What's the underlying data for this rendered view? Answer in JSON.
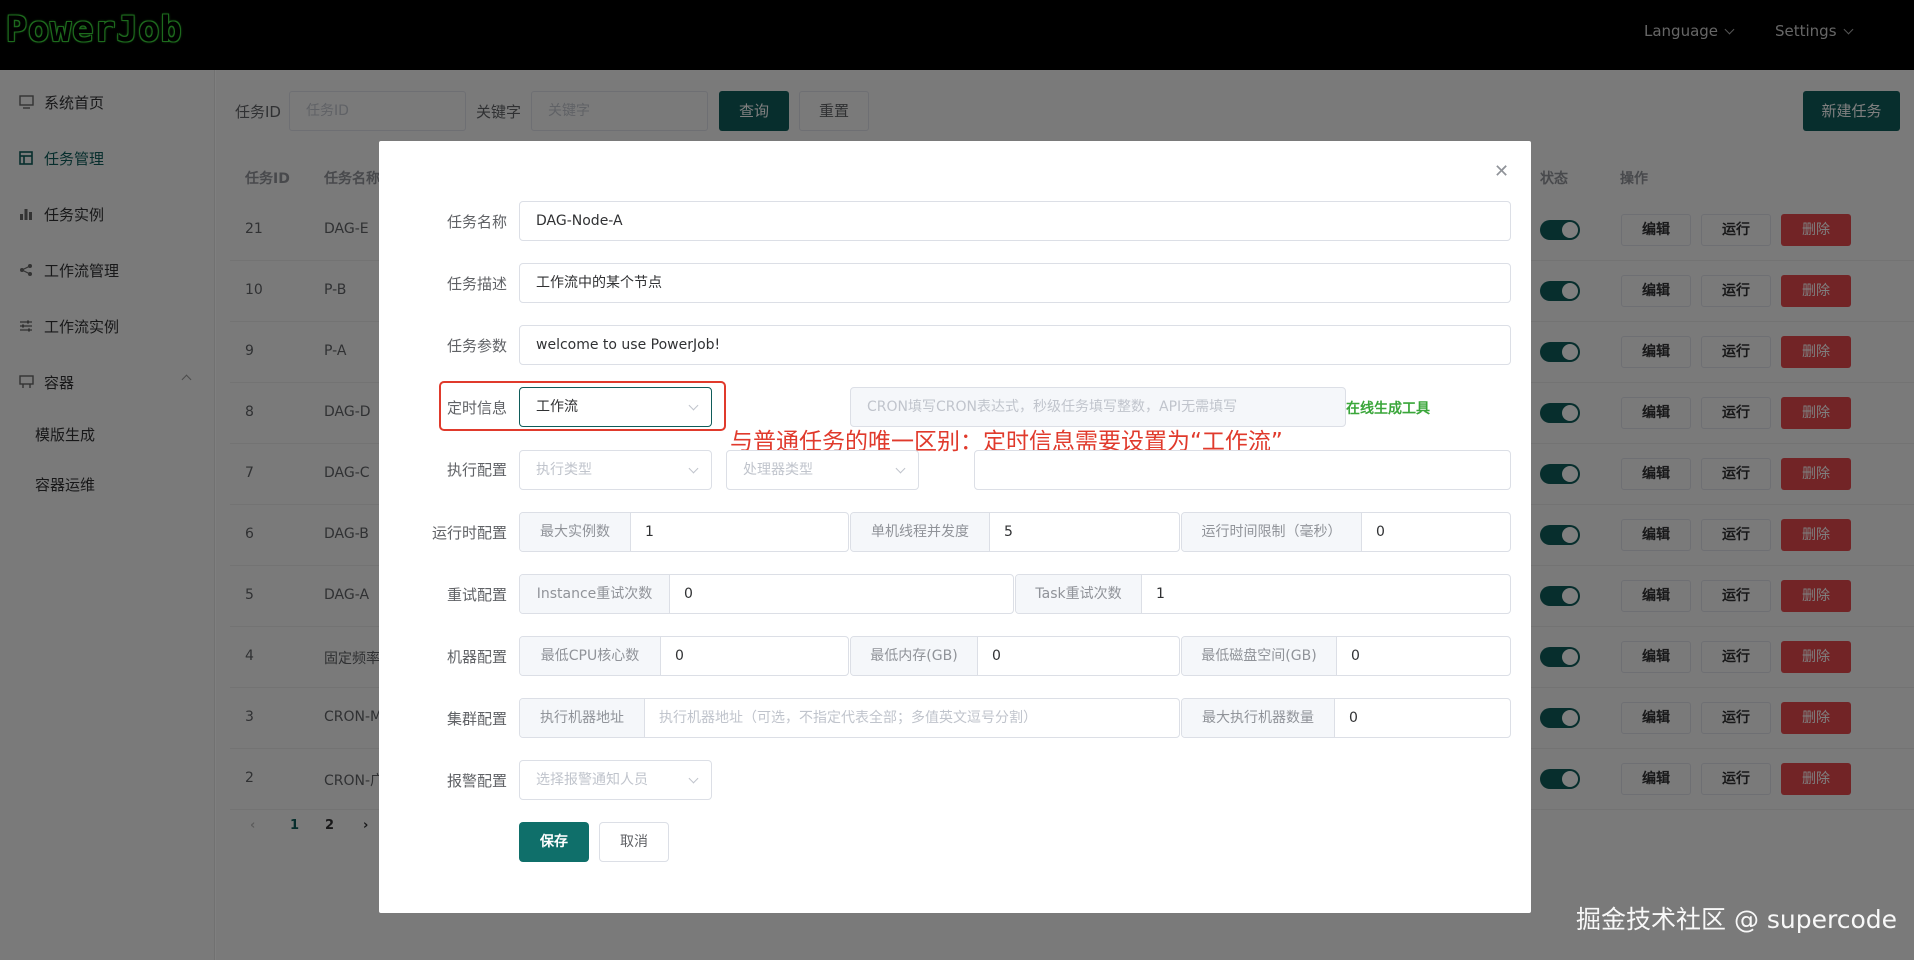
{
  "header": {
    "logo": "PowerJob",
    "language": "Language",
    "settings": "Settings"
  },
  "sidebar": {
    "items": [
      {
        "label": "系统首页",
        "icon": "monitor-icon"
      },
      {
        "label": "任务管理",
        "icon": "grid-icon"
      },
      {
        "label": "任务实例",
        "icon": "bar-chart-icon"
      },
      {
        "label": "工作流管理",
        "icon": "share-icon"
      },
      {
        "label": "工作流实例",
        "icon": "sliders-icon"
      },
      {
        "label": "容器",
        "icon": "container-icon"
      }
    ],
    "sub_items": [
      "模版生成",
      "容器运维"
    ]
  },
  "search": {
    "id_label": "任务ID",
    "id_placeholder": "任务ID",
    "keyword_label": "关键字",
    "keyword_placeholder": "关键字",
    "query": "查询",
    "reset": "重置",
    "new_task": "新建任务"
  },
  "table": {
    "headers": {
      "id": "任务ID",
      "name": "任务名称",
      "status": "状态",
      "ops": "操作"
    },
    "actions": {
      "edit": "编辑",
      "run": "运行",
      "delete": "删除"
    },
    "rows": [
      {
        "id": "21",
        "name": "DAG-E"
      },
      {
        "id": "10",
        "name": "P-B"
      },
      {
        "id": "9",
        "name": "P-A"
      },
      {
        "id": "8",
        "name": "DAG-D"
      },
      {
        "id": "7",
        "name": "DAG-C"
      },
      {
        "id": "6",
        "name": "DAG-B"
      },
      {
        "id": "5",
        "name": "DAG-A"
      },
      {
        "id": "4",
        "name": "固定频率"
      },
      {
        "id": "3",
        "name": "CRON-M"
      },
      {
        "id": "2",
        "name": "CRON-广"
      }
    ],
    "pages": [
      "1",
      "2"
    ]
  },
  "dialog": {
    "task_name": {
      "label": "任务名称",
      "value": "DAG-Node-A"
    },
    "task_desc": {
      "label": "任务描述",
      "value": "工作流中的某个节点"
    },
    "task_params": {
      "label": "任务参数",
      "value": "welcome to use PowerJob!"
    },
    "timing": {
      "label": "定时信息",
      "type_value": "工作流",
      "expression_placeholder": "CRON填写CRON表达式，秒级任务填写整数，API无需填写",
      "online_tool": "在线生成工具"
    },
    "exec": {
      "label": "执行配置",
      "exec_type_placeholder": "执行类型",
      "processor_type_placeholder": "处理器类型"
    },
    "runtime": {
      "label": "运行时配置",
      "max_instances": {
        "prefix": "最大实例数",
        "value": "1"
      },
      "thread_concurrency": {
        "prefix": "单机线程并发度",
        "value": "5"
      },
      "time_limit": {
        "prefix": "运行时间限制（毫秒）",
        "value": "0"
      }
    },
    "retry": {
      "label": "重试配置",
      "instance_retry": {
        "prefix": "Instance重试次数",
        "value": "0"
      },
      "task_retry": {
        "prefix": "Task重试次数",
        "value": "1"
      }
    },
    "machine": {
      "label": "机器配置",
      "min_cpu": {
        "prefix": "最低CPU核心数",
        "value": "0"
      },
      "min_memory": {
        "prefix": "最低内存(GB)",
        "value": "0"
      },
      "min_disk": {
        "prefix": "最低磁盘空间(GB)",
        "value": "0"
      }
    },
    "cluster": {
      "label": "集群配置",
      "address": {
        "prefix": "执行机器地址",
        "placeholder": "执行机器地址（可选，不指定代表全部；多值英文逗号分割）"
      },
      "max_machines": {
        "prefix": "最大执行机器数量",
        "value": "0"
      }
    },
    "alarm": {
      "label": "报警配置",
      "placeholder": "选择报警通知人员"
    },
    "save": "保存",
    "cancel": "取消"
  },
  "annotation": "与普通任务的唯一区别：定时信息需要设置为“工作流”",
  "watermark": "掘金技术社区 @ supercode",
  "colors": {
    "accent": "#0f5c5a",
    "danger": "#e5484d",
    "annotation": "#e03a2c",
    "link": "#3aa63a"
  }
}
